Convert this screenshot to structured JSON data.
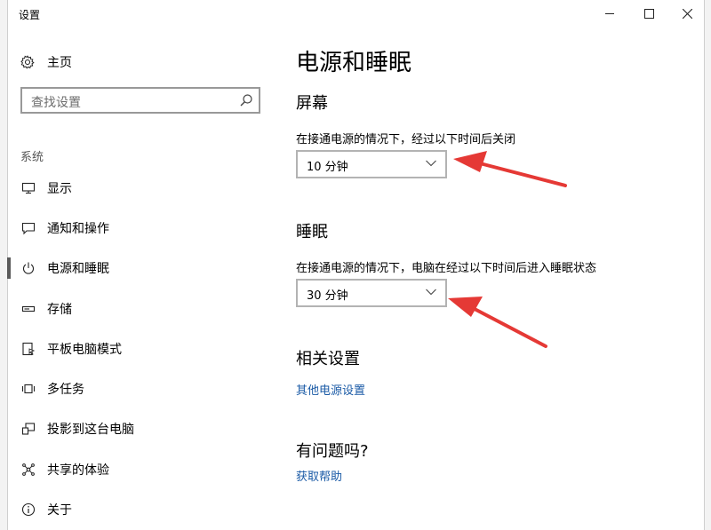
{
  "window": {
    "title": "设置"
  },
  "sidebar": {
    "home": "主页",
    "search_placeholder": "查找设置",
    "section": "系统",
    "items": [
      {
        "label": "显示",
        "icon": "monitor-icon"
      },
      {
        "label": "通知和操作",
        "icon": "notification-icon"
      },
      {
        "label": "电源和睡眠",
        "icon": "power-icon",
        "active": true
      },
      {
        "label": "存储",
        "icon": "storage-icon"
      },
      {
        "label": "平板电脑模式",
        "icon": "tablet-icon"
      },
      {
        "label": "多任务",
        "icon": "multitask-icon"
      },
      {
        "label": "投影到这台电脑",
        "icon": "project-icon"
      },
      {
        "label": "共享的体验",
        "icon": "share-icon"
      },
      {
        "label": "关于",
        "icon": "info-icon"
      }
    ]
  },
  "main": {
    "title": "电源和睡眠",
    "screen": {
      "heading": "屏幕",
      "desc": "在接通电源的情况下，经过以下时间后关闭",
      "value": "10 分钟"
    },
    "sleep": {
      "heading": "睡眠",
      "desc": "在接通电源的情况下，电脑在经过以下时间后进入睡眠状态",
      "value": "30 分钟"
    },
    "related": {
      "heading": "相关设置",
      "link": "其他电源设置"
    },
    "help": {
      "heading": "有问题吗?",
      "link": "获取帮助"
    }
  },
  "annotation_color": "#e53935"
}
